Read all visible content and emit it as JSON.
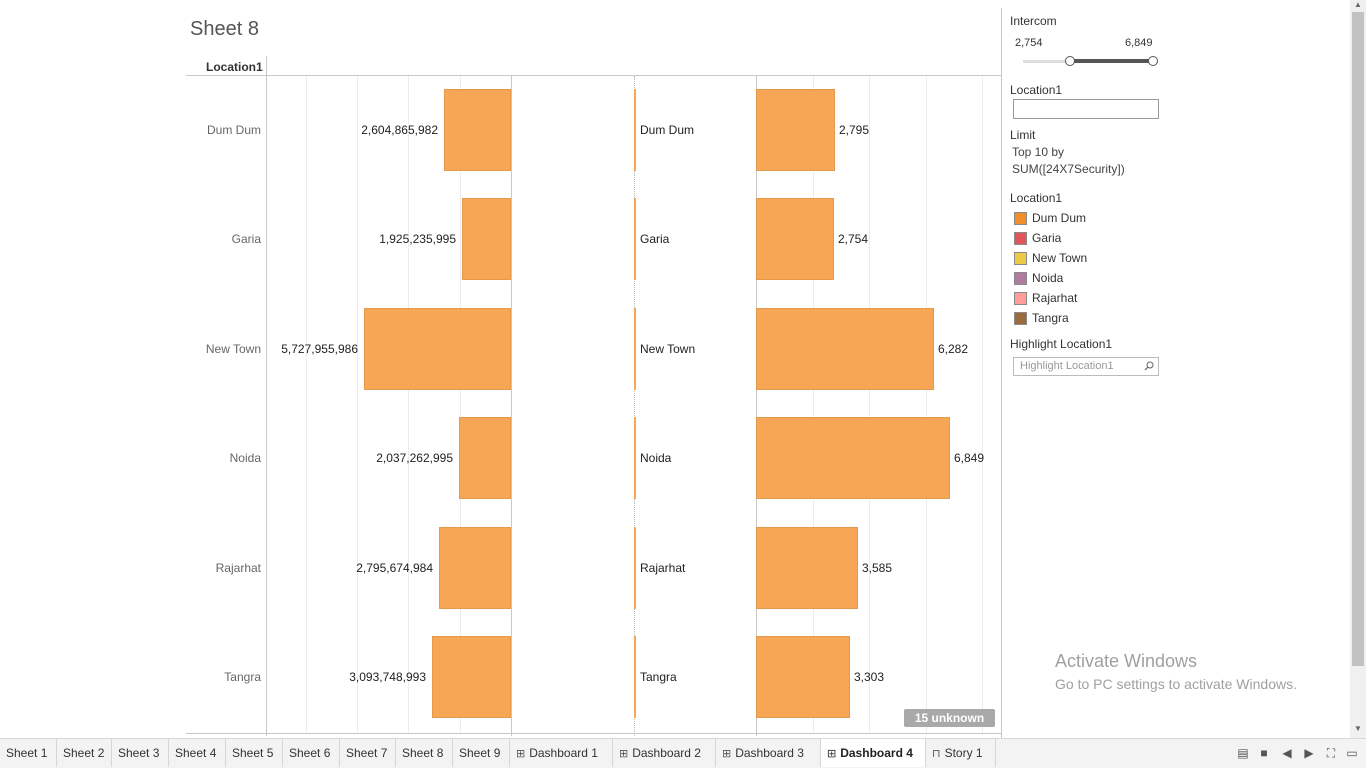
{
  "sheet": {
    "title": "Sheet 8",
    "column_header": "Location1"
  },
  "chart_data": {
    "type": "bar",
    "categories": [
      "Dum Dum",
      "Garia",
      "New Town",
      "Noida",
      "Rajarhat",
      "Tangra"
    ],
    "series": [
      {
        "values": [
          2604865982,
          1925235995,
          5727955986,
          2037262995,
          2795674984,
          3093748993
        ]
      },
      {
        "values": [
          2795,
          2754,
          6282,
          6849,
          3585,
          3303
        ]
      }
    ],
    "left_labels": [
      "2,604,865,982",
      "1,925,235,995",
      "5,727,955,986",
      "2,037,262,995",
      "2,795,674,984",
      "3,093,748,993"
    ],
    "right_labels": [
      "2,795",
      "2,754",
      "6,282",
      "6,849",
      "3,585",
      "3,303"
    ],
    "bar_color": "#f6a654"
  },
  "badge": {
    "text": "15 unknown"
  },
  "panel": {
    "intercom": {
      "title": "Intercom",
      "min": "2,754",
      "max": "6,849",
      "range_low": 2754,
      "range_high": 6849
    },
    "location_filter": {
      "title": "Location1",
      "value": ""
    },
    "limit": {
      "title": "Limit",
      "line1": "Top 10 by",
      "line2": "SUM([24X7Security])"
    },
    "legend": {
      "title": "Location1",
      "items": [
        {
          "label": "Dum Dum",
          "color": "#f28e2b"
        },
        {
          "label": "Garia",
          "color": "#e15759"
        },
        {
          "label": "New Town",
          "color": "#edc948"
        },
        {
          "label": "Noida",
          "color": "#b07aa1"
        },
        {
          "label": "Rajarhat",
          "color": "#ff9d9a"
        },
        {
          "label": "Tangra",
          "color": "#9c6b3c"
        }
      ]
    },
    "highlight": {
      "title": "Highlight Location1",
      "placeholder": "Highlight Location1"
    }
  },
  "watermark": {
    "title": "Activate Windows",
    "subtitle": "Go to PC settings to activate Windows."
  },
  "tabs": [
    {
      "label": "Sheet 1",
      "icon": ""
    },
    {
      "label": "Sheet 2",
      "icon": ""
    },
    {
      "label": "Sheet 3",
      "icon": ""
    },
    {
      "label": "Sheet 4",
      "icon": ""
    },
    {
      "label": "Sheet 5",
      "icon": ""
    },
    {
      "label": "Sheet 6",
      "icon": ""
    },
    {
      "label": "Sheet 7",
      "icon": ""
    },
    {
      "label": "Sheet 8",
      "icon": ""
    },
    {
      "label": "Sheet 9",
      "icon": ""
    },
    {
      "label": "Dashboard 1",
      "icon": "dashboard-icon"
    },
    {
      "label": "Dashboard 2",
      "icon": "dashboard-icon"
    },
    {
      "label": "Dashboard 3",
      "icon": "dashboard-icon"
    },
    {
      "label": "Dashboard 4",
      "icon": "dashboard-icon",
      "active": true
    },
    {
      "label": "Story 1",
      "icon": "story-icon"
    }
  ]
}
